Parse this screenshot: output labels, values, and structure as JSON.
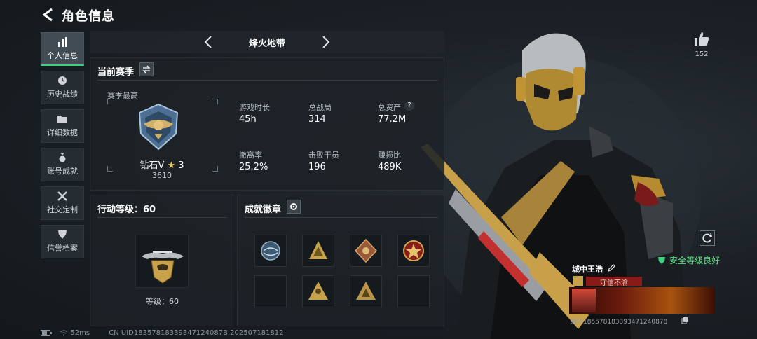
{
  "header": {
    "title": "角色信息"
  },
  "nav": {
    "items": [
      {
        "label": "个人信息",
        "icon": "bar-chart-icon",
        "active": true
      },
      {
        "label": "历史战绩",
        "icon": "clock-icon",
        "active": false
      },
      {
        "label": "详细数据",
        "icon": "folder-icon",
        "active": false
      },
      {
        "label": "账号成就",
        "icon": "medal-icon",
        "active": false
      },
      {
        "label": "社交定制",
        "icon": "tools-icon",
        "active": false
      },
      {
        "label": "信誉档案",
        "icon": "shield-icon",
        "active": false
      }
    ]
  },
  "season": {
    "name": "烽火地带",
    "panel_title": "当前赛季",
    "peak_label": "赛季最高",
    "rank": {
      "name": "钻石V",
      "star": "★",
      "stars": "3",
      "score": "3610"
    },
    "stats": [
      {
        "label": "游戏时长",
        "value": "45h"
      },
      {
        "label": "总战局",
        "value": "314"
      },
      {
        "label": "总资产",
        "value": "77.2M",
        "help": "?"
      },
      {
        "label": "撤离率",
        "value": "25.2%"
      },
      {
        "label": "击败干员",
        "value": "196"
      },
      {
        "label": "赚损比",
        "value": "489K"
      }
    ]
  },
  "action_level": {
    "title": "行动等级：60",
    "level_label": "等级：60"
  },
  "badges": {
    "title": "成就徽章",
    "filled_count": 6,
    "slot_count": 8
  },
  "like": {
    "count": "152"
  },
  "player": {
    "name": "城中王浩",
    "motto": "守信不渝",
    "credit": "安全等级良好",
    "uid": "编号185578183393471240878"
  },
  "status_bar": {
    "ping": "52ms",
    "cn_uid": "CN UID18357818339347124087B,202507181812"
  },
  "colors": {
    "accent_green": "#3fd07e",
    "gold": "#c8a24a",
    "text_gray": "#b4bbc1"
  }
}
